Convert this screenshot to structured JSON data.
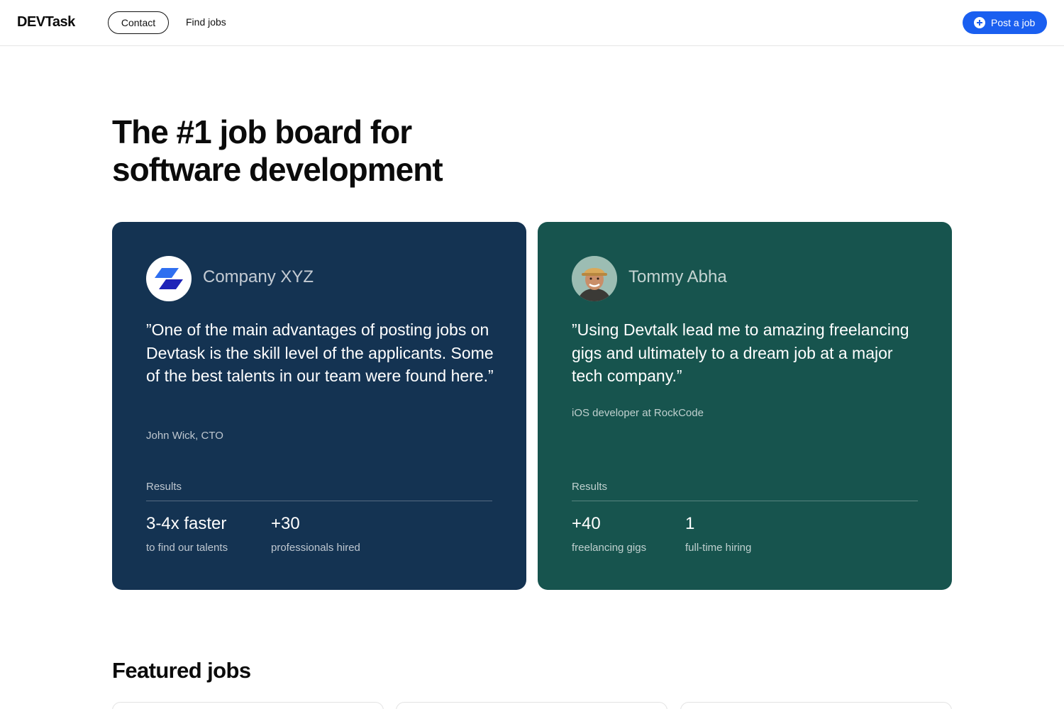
{
  "header": {
    "brand": "DEVTask",
    "nav": {
      "contact": "Contact",
      "find_jobs": "Find jobs"
    },
    "post_button": {
      "label": "Post a job",
      "icon": "plus-circle-icon",
      "color": "#1a5ff0"
    }
  },
  "hero": {
    "title_line1": "The #1 job board for",
    "title_line2": "software development"
  },
  "testimonials": [
    {
      "name": "Company XYZ",
      "avatar": "company-logo",
      "background": "#143352",
      "quote": "”One of the main advantages of posting jobs on Devtask is the skill level of the applicants. Some of the best talents in our team were found here.”",
      "author": "John Wick, CTO",
      "results_label": "Results",
      "stats": [
        {
          "value": "3-4x faster",
          "caption": "to find our talents"
        },
        {
          "value": "+30",
          "caption": "professionals hired"
        }
      ]
    },
    {
      "name": "Tommy Abha",
      "avatar": "person-photo",
      "background": "#17544e",
      "quote": "”Using Devtalk lead me to amazing freelancing gigs and ultimately to a dream job at a major tech company.”",
      "author": "iOS developer at RockCode",
      "results_label": "Results",
      "stats": [
        {
          "value": "+40",
          "caption": "freelancing gigs"
        },
        {
          "value": "1",
          "caption": "full-time hiring"
        }
      ]
    }
  ],
  "featured": {
    "title": "Featured jobs"
  }
}
